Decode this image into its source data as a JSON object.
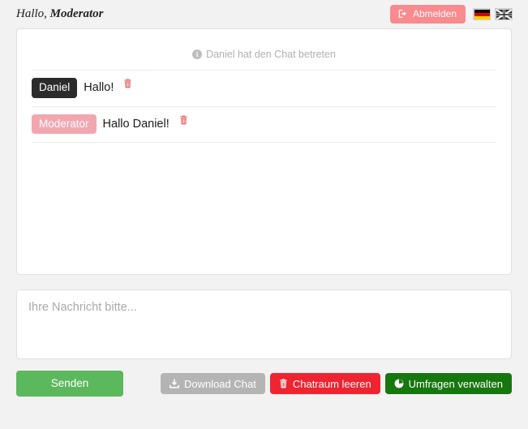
{
  "header": {
    "greeting_prefix": "Hallo,",
    "user_name": "Moderator",
    "logout_label": "Abmelden",
    "logout_icon": "sign-out-icon",
    "flags": [
      {
        "name": "flag-de",
        "title": "Deutsch"
      },
      {
        "name": "flag-en",
        "title": "English"
      }
    ],
    "logout_color": "#f98a8e"
  },
  "chat": {
    "system_message": "Daniel hat den Chat betreten",
    "system_icon": "info-circle-icon",
    "system_icon_char": "i",
    "messages": [
      {
        "author": "Daniel",
        "text": "Hallo!",
        "badge_style": "dark",
        "badge_color": "#2b2b2b",
        "delete_icon": "trash-icon"
      },
      {
        "author": "Moderator",
        "text": "Hallo Daniel!",
        "badge_style": "pink",
        "badge_color": "#f2a7af",
        "delete_icon": "trash-icon"
      }
    ]
  },
  "composer": {
    "placeholder": "Ihre Nachricht bitte...",
    "value": ""
  },
  "toolbar": {
    "send_label": "Senden",
    "send_color": "#5cb85c",
    "download_label": "Download Chat",
    "download_icon": "download-icon",
    "download_color": "#b4b4b4",
    "clear_label": "Chatraum leeren",
    "clear_icon": "trash-icon",
    "clear_color": "#ef2430",
    "polls_label": "Umfragen verwalten",
    "polls_icon": "pie-chart-icon",
    "polls_color": "#17770f"
  }
}
